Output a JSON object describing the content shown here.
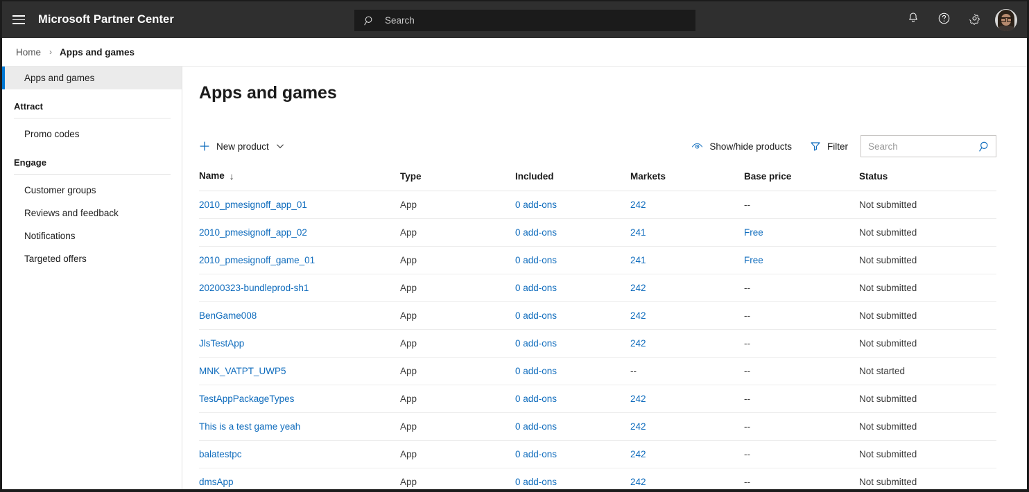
{
  "header": {
    "menu_label": "Global navigation menu",
    "brand": "Microsoft Partner Center",
    "search": {
      "placeholder": "Search",
      "value": ""
    },
    "icons": {
      "notifications": "bell-icon",
      "help": "help-icon",
      "settings": "gear-icon",
      "account": "user-avatar"
    }
  },
  "breadcrumb": {
    "home": "Home",
    "separator": "›",
    "current": "Apps and games"
  },
  "sidebar": {
    "primary": {
      "label": "Apps and games",
      "selected": true
    },
    "groups": [
      {
        "title": "Attract",
        "items": [
          {
            "label": "Promo codes"
          }
        ]
      },
      {
        "title": "Engage",
        "items": [
          {
            "label": "Customer groups"
          },
          {
            "label": "Reviews and feedback"
          },
          {
            "label": "Notifications"
          },
          {
            "label": "Targeted offers"
          }
        ]
      }
    ]
  },
  "main": {
    "title": "Apps and games",
    "toolbar": {
      "new_product": "New product",
      "new_product_icon": "plus-icon",
      "new_product_chevron": "chevron-down-icon",
      "show_hide": "Show/hide products",
      "show_hide_icon": "eye-icon",
      "filter": "Filter",
      "filter_icon": "funnel-icon",
      "search": {
        "placeholder": "Search",
        "value": "",
        "icon": "search-icon"
      }
    },
    "table": {
      "columns": [
        {
          "key": "name",
          "label": "Name",
          "sort": "↓"
        },
        {
          "key": "type",
          "label": "Type"
        },
        {
          "key": "included",
          "label": "Included"
        },
        {
          "key": "markets",
          "label": "Markets"
        },
        {
          "key": "base_price",
          "label": "Base price"
        },
        {
          "key": "status",
          "label": "Status"
        }
      ],
      "rows": [
        {
          "name": "2010_pmesignoff_app_01",
          "type": "App",
          "included": "0 add-ons",
          "markets": "242",
          "markets_link": true,
          "base_price": "--",
          "price_link": false,
          "status": "Not submitted"
        },
        {
          "name": "2010_pmesignoff_app_02",
          "type": "App",
          "included": "0 add-ons",
          "markets": "241",
          "markets_link": true,
          "base_price": "Free",
          "price_link": true,
          "status": "Not submitted"
        },
        {
          "name": "2010_pmesignoff_game_01",
          "type": "App",
          "included": "0 add-ons",
          "markets": "241",
          "markets_link": true,
          "base_price": "Free",
          "price_link": true,
          "status": "Not submitted"
        },
        {
          "name": "20200323-bundleprod-sh1",
          "type": "App",
          "included": "0 add-ons",
          "markets": "242",
          "markets_link": true,
          "base_price": "--",
          "price_link": false,
          "status": "Not submitted"
        },
        {
          "name": "BenGame008",
          "type": "App",
          "included": "0 add-ons",
          "markets": "242",
          "markets_link": true,
          "base_price": "--",
          "price_link": false,
          "status": "Not submitted"
        },
        {
          "name": "JlsTestApp",
          "type": "App",
          "included": "0 add-ons",
          "markets": "242",
          "markets_link": true,
          "base_price": "--",
          "price_link": false,
          "status": "Not submitted"
        },
        {
          "name": "MNK_VATPT_UWP5",
          "type": "App",
          "included": "0 add-ons",
          "markets": "--",
          "markets_link": false,
          "base_price": "--",
          "price_link": false,
          "status": "Not started"
        },
        {
          "name": "TestAppPackageTypes",
          "type": "App",
          "included": "0 add-ons",
          "markets": "242",
          "markets_link": true,
          "base_price": "--",
          "price_link": false,
          "status": "Not submitted"
        },
        {
          "name": "This is a test game yeah",
          "type": "App",
          "included": "0 add-ons",
          "markets": "242",
          "markets_link": true,
          "base_price": "--",
          "price_link": false,
          "status": "Not submitted"
        },
        {
          "name": "balatestpc",
          "type": "App",
          "included": "0 add-ons",
          "markets": "242",
          "markets_link": true,
          "base_price": "--",
          "price_link": false,
          "status": "Not submitted"
        },
        {
          "name": "dmsApp",
          "type": "App",
          "included": "0 add-ons",
          "markets": "242",
          "markets_link": true,
          "base_price": "--",
          "price_link": false,
          "status": "Not submitted"
        }
      ]
    }
  },
  "colors": {
    "topbar_bg": "#2f2f2f",
    "topsearch_bg": "#1b1b1b",
    "accent": "#0078d4",
    "link": "#0f6cbd",
    "selected_bg": "#ebebeb",
    "text": "#1b1b1b"
  }
}
